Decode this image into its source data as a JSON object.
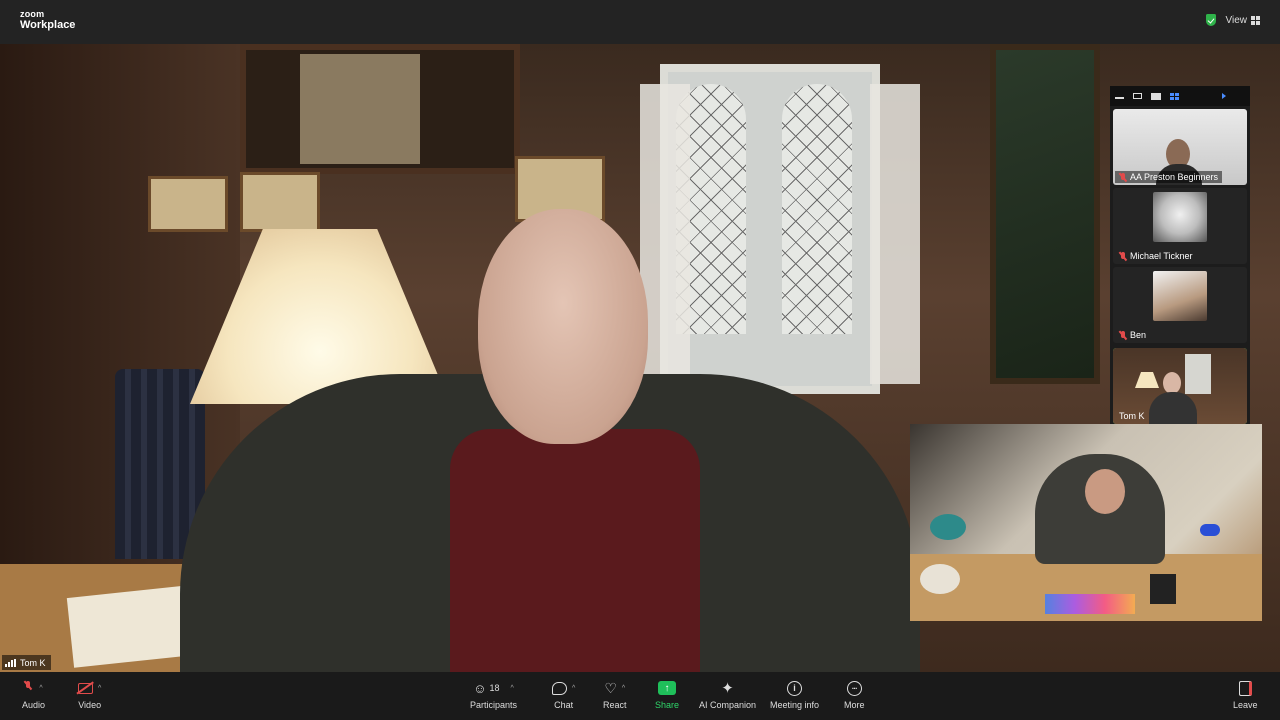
{
  "app": {
    "brand_small": "zoom",
    "brand_name": "Workplace"
  },
  "titlebar": {
    "view_label": "View",
    "encryption_icon": "shield-check-icon",
    "view_icon": "grid-icon"
  },
  "main_video": {
    "speaker_name": "Tom K",
    "signal_icon": "signal-bars-icon"
  },
  "thumbnails": {
    "toolbar_icons": [
      "minimize-icon",
      "strip-view-icon",
      "speaker-view-icon",
      "gallery-view-icon",
      "next-page-icon"
    ],
    "tiles": [
      {
        "name": "AA Preston Beginners",
        "muted": true,
        "active": false
      },
      {
        "name": "Michael Tickner",
        "muted": true,
        "active": false
      },
      {
        "name": "Ben",
        "muted": true,
        "active": false
      },
      {
        "name": "Tom K",
        "muted": false,
        "active": true
      }
    ]
  },
  "toolbar": {
    "audio": {
      "label": "Audio",
      "icon": "mic-muted-icon"
    },
    "video": {
      "label": "Video",
      "icon": "camera-off-icon"
    },
    "participants": {
      "label": "Participants",
      "icon": "participants-icon",
      "count": "18"
    },
    "chat": {
      "label": "Chat",
      "icon": "chat-icon"
    },
    "react": {
      "label": "React",
      "icon": "heart-icon"
    },
    "share": {
      "label": "Share",
      "icon": "share-screen-icon"
    },
    "ai_companion": {
      "label": "AI Companion",
      "icon": "sparkle-icon"
    },
    "meeting_info": {
      "label": "Meeting info",
      "icon": "info-icon"
    },
    "more": {
      "label": "More",
      "icon": "more-dots-icon"
    },
    "leave": {
      "label": "Leave",
      "icon": "leave-icon"
    }
  },
  "colors": {
    "active_speaker_border": "#4ee56b",
    "share_accent": "#1fbf5a",
    "muted_red": "#e24b4b",
    "leave_red": "#e24b4b"
  }
}
